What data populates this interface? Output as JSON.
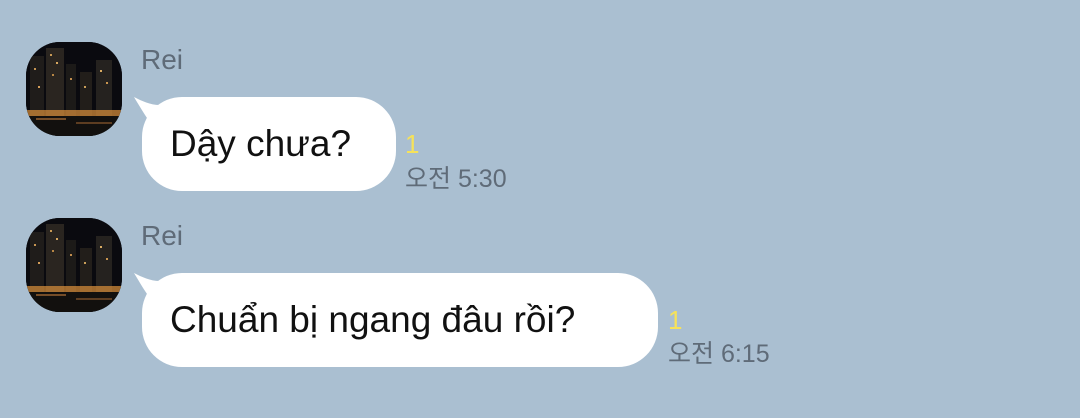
{
  "colors": {
    "background": "#aabfd1",
    "bubble": "#ffffff",
    "unread": "#f6e25a",
    "meta_text": "#5f6b78"
  },
  "messages": [
    {
      "sender": "Rei",
      "avatar_icon": "city-night-avatar",
      "text": "Dậy chưa?",
      "unread": "1",
      "time": "오전 5:30"
    },
    {
      "sender": "Rei",
      "avatar_icon": "city-night-avatar",
      "text": "Chuẩn bị ngang đâu rồi?",
      "unread": "1",
      "time": "오전 6:15"
    }
  ]
}
